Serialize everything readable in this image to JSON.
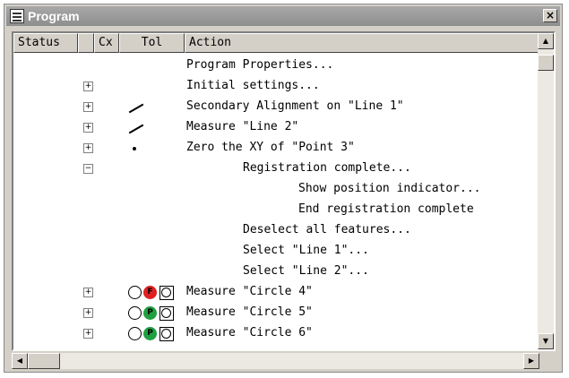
{
  "window": {
    "title": "Program",
    "close_label": "×"
  },
  "columns": [
    "Status",
    "",
    "Cx",
    "Tol",
    "Action"
  ],
  "rows": [
    {
      "expander": "",
      "symbol": "",
      "action": "Program Properties...",
      "indent": 0
    },
    {
      "expander": "+",
      "symbol": "",
      "action": "Initial settings...",
      "indent": 0
    },
    {
      "expander": "+",
      "symbol": "line",
      "action": "Secondary Alignment on \"Line 1\"",
      "indent": 0
    },
    {
      "expander": "+",
      "symbol": "line",
      "action": "Measure \"Line 2\"",
      "indent": 0
    },
    {
      "expander": "+",
      "symbol": "point",
      "action": "Zero the XY of \"Point 3\"",
      "indent": 0
    },
    {
      "expander": "−",
      "symbol": "",
      "action": "Registration complete...",
      "indent": 1
    },
    {
      "expander": "",
      "symbol": "",
      "action": "Show position indicator...",
      "indent": 2
    },
    {
      "expander": "",
      "symbol": "",
      "action": "End registration complete",
      "indent": 2
    },
    {
      "expander": "",
      "symbol": "",
      "action": "Deselect all features...",
      "indent": 1
    },
    {
      "expander": "",
      "symbol": "",
      "action": "Select \"Line 1\"...",
      "indent": 1
    },
    {
      "expander": "",
      "symbol": "",
      "action": "Select \"Line 2\"...",
      "indent": 1
    },
    {
      "expander": "+",
      "symbol": "circle",
      "status": "F",
      "status_color": "#e02020",
      "action": "Measure \"Circle 4\"",
      "indent": 0
    },
    {
      "expander": "+",
      "symbol": "circle",
      "status": "P",
      "status_color": "#20a040",
      "action": "Measure \"Circle 5\"",
      "indent": 0
    },
    {
      "expander": "+",
      "symbol": "circle",
      "status": "P",
      "status_color": "#20a040",
      "action": "Measure \"Circle 6\"",
      "indent": 0
    }
  ],
  "icons": {
    "scroll_up": "▲",
    "scroll_down": "▼",
    "scroll_left": "◀",
    "scroll_right": "▶"
  },
  "colors": {
    "title_bar": "#9a9a9a",
    "fail": "#e02020",
    "pass": "#20a040"
  }
}
